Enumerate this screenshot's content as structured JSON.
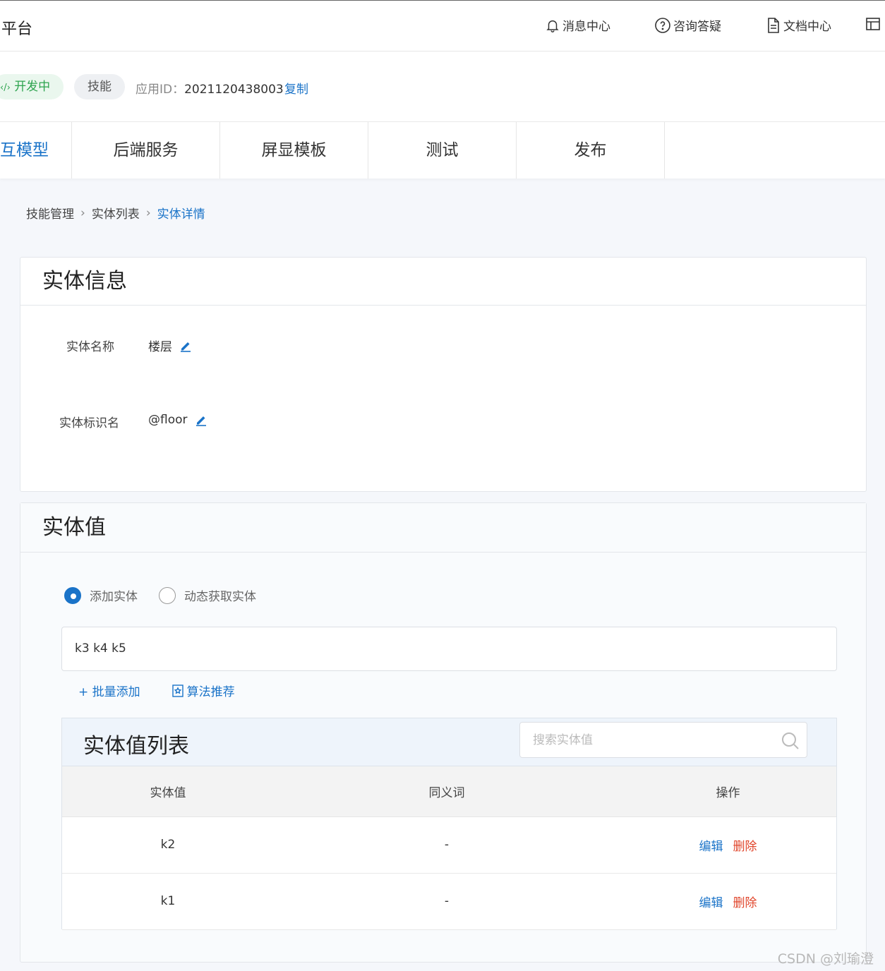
{
  "header": {
    "title": "平台",
    "nav": [
      {
        "label": "消息中心",
        "icon": "bell-icon"
      },
      {
        "label": "咨询答疑",
        "icon": "question-circle-icon"
      },
      {
        "label": "文档中心",
        "icon": "document-icon"
      }
    ]
  },
  "app_info": {
    "status": "开发中",
    "type": "技能",
    "app_id_label": "应用ID：",
    "app_id": "2021120438003",
    "copy_label": "复制"
  },
  "tabs": [
    {
      "label": "互模型",
      "active": true
    },
    {
      "label": "后端服务",
      "active": false
    },
    {
      "label": "屏显模板",
      "active": false
    },
    {
      "label": "测试",
      "active": false
    },
    {
      "label": "发布",
      "active": false
    }
  ],
  "breadcrumb": [
    "技能管理",
    "实体列表",
    "实体详情"
  ],
  "entity_info": {
    "title": "实体信息",
    "name_label": "实体名称",
    "name_value": "楼层",
    "id_label": "实体标识名",
    "id_value": "@floor"
  },
  "entity_values": {
    "title": "实体值",
    "radio_add": "添加实体",
    "radio_dynamic": "动态获取实体",
    "input_value": "k3 k4 k5",
    "batch_add": "+ 批量添加",
    "algo_recommend": "算法推荐",
    "list_title": "实体值列表",
    "search_placeholder": "搜索实体值",
    "columns": [
      "实体值",
      "同义词",
      "操作"
    ],
    "rows": [
      {
        "value": "k2",
        "synonym": "-",
        "edit": "编辑",
        "delete": "删除"
      },
      {
        "value": "k1",
        "synonym": "-",
        "edit": "编辑",
        "delete": "删除"
      }
    ]
  },
  "watermark": "CSDN @刘瑜澄",
  "colors": {
    "accent": "#1a73c8",
    "status_green": "#2ea44f",
    "danger": "#e0452b"
  }
}
